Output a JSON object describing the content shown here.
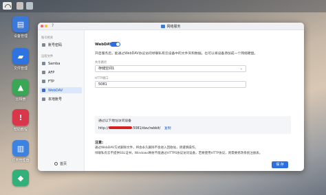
{
  "window": {
    "title": "网络服务",
    "help": "?"
  },
  "sidebar": {
    "section_account": "账号相关",
    "account_items": [
      {
        "label": "账号密码"
      }
    ],
    "section_files": "远程文件",
    "file_items": [
      {
        "label": "Samba"
      },
      {
        "label": "AFP"
      },
      {
        "label": "FTP"
      },
      {
        "label": "WebDAV"
      },
      {
        "label": "本地账号"
      }
    ],
    "home": "首页"
  },
  "webdav": {
    "title": "WebDAV",
    "enabled": true,
    "description": "开启服务后，能通过WebDAV协议访问绿联私有云设备中的文件夹和数据。也可以将设备添加成一个网络硬盘。",
    "share_label": "共享路径",
    "share_value": "存储空间1",
    "port_label": "HTTP端口",
    "port_value": "5081",
    "url_hint": "通过以下地址访问设备",
    "url_prefix": "http://",
    "url_suffix": ":5081/dav/rabbit/",
    "copy_label": "复制",
    "notes_title": "注意:",
    "note1": "通过WebDAV方式删除文件，将会永久删除不会进入回收站，请谨慎操作。",
    "note2": "绿联私有云不提供SSL证书，Windows映射不能通过HTTPS协议访问设备，若要使用HTTP协议，则需要修改系统注册表。",
    "ok_label": "保 存"
  },
  "desktop_icons": [
    {
      "label": "设备管理",
      "icon": "storage-icon",
      "color": "#3b78d8"
    },
    {
      "label": "文件管理",
      "icon": "folder-icon",
      "color": "#2f73e0"
    },
    {
      "label": "云相册",
      "icon": "photos-icon",
      "color": "#3aa757"
    },
    {
      "label": "帮助教程",
      "icon": "help-icon",
      "color": "#d9364b"
    },
    {
      "label": "任务管理器",
      "icon": "task-manager-icon",
      "color": "#3c82e0"
    },
    {
      "label": "",
      "icon": "app-icon",
      "color": "#33b07a"
    }
  ],
  "colors": {
    "accent": "#2d6fe0",
    "link": "#1a5ed1",
    "redact": "#d62020"
  }
}
